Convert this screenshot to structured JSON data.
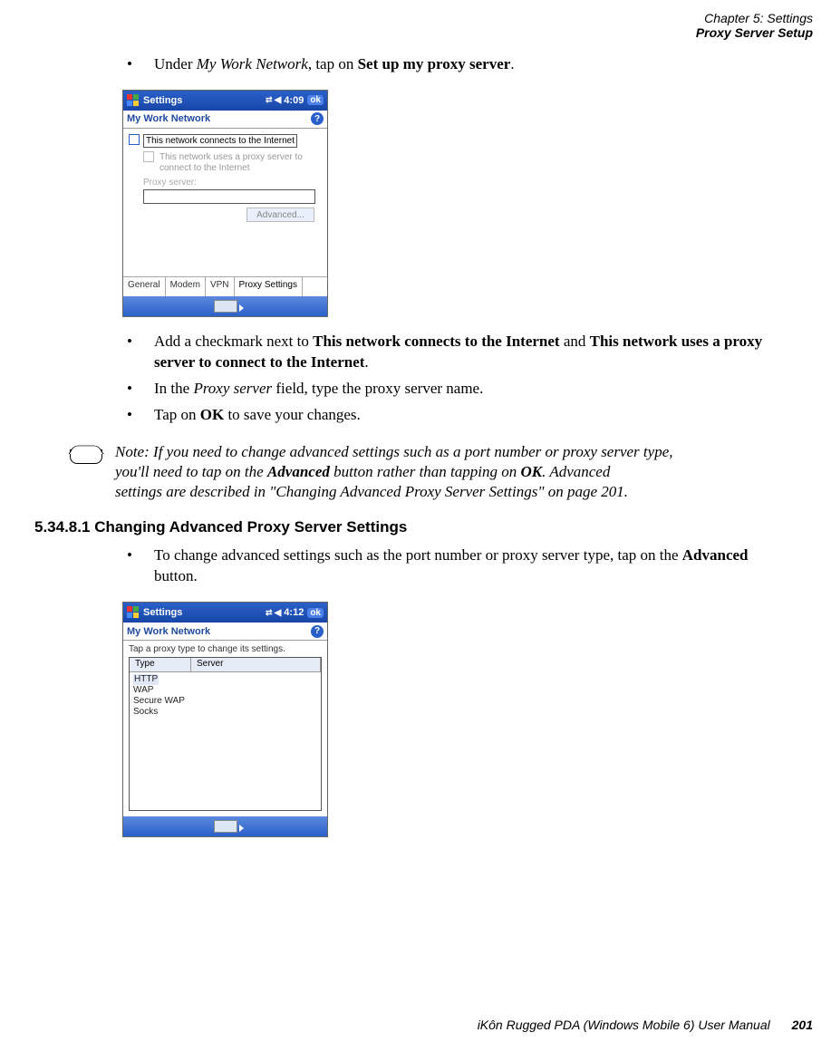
{
  "header": {
    "chapter": "Chapter 5:  Settings",
    "section": "Proxy Server Setup"
  },
  "step1": {
    "pre": "Under ",
    "it": "My Work Network",
    "mid": ", tap on ",
    "bd": "Set up my proxy server",
    "post": "."
  },
  "shot1": {
    "title": "Settings",
    "time": "4:09",
    "ok": "ok",
    "sub": "My Work Network",
    "help": "?",
    "cb1": "This network connects to the Internet",
    "cb2": "This network uses a proxy server to connect to the Internet",
    "lbl": "Proxy server:",
    "adv": "Advanced...",
    "tabs": {
      "a": "General",
      "b": "Modem",
      "c": "VPN",
      "d": "Proxy Settings"
    }
  },
  "step2": {
    "pre": "Add a checkmark next to ",
    "b1": "This network connects to the Internet",
    "mid": " and ",
    "b2": "This network uses a proxy server to connect to the Internet",
    "post": "."
  },
  "step3": {
    "pre": "In the ",
    "it": "Proxy server",
    "post": " field, type the proxy server name."
  },
  "step4": {
    "pre": "Tap on ",
    "bd": "OK",
    "post": " to save your changes."
  },
  "note": {
    "label": "Note:",
    "l1a": "If you need to change advanced settings such as a port number or proxy server type, ",
    "l2a": "you'll need to tap on the ",
    "l2b": "Advanced",
    "l2c": " button rather than tapping on ",
    "l2d": "OK",
    "l2e": ". Advanced ",
    "l3": "settings are described in \"Changing Advanced Proxy Server Settings\" on page 201."
  },
  "subsection": {
    "num": "5.34.8.1",
    "title": "Changing Advanced Proxy Server Settings"
  },
  "step5": {
    "pre": "To change advanced settings such as the port number or proxy server type, tap on the ",
    "bd": "Advanced",
    "post": " button."
  },
  "shot2": {
    "title": "Settings",
    "time": "4:12",
    "ok": "ok",
    "sub": "My Work Network",
    "help": "?",
    "hint": "Tap a proxy type to change its settings.",
    "cols": {
      "a": "Type",
      "b": "Server"
    },
    "rows": {
      "a": "HTTP",
      "b": "WAP",
      "c": "Secure WAP",
      "d": "Socks"
    }
  },
  "footer": {
    "book": "iKôn Rugged PDA (Windows Mobile 6) User Manual",
    "page": "201"
  }
}
